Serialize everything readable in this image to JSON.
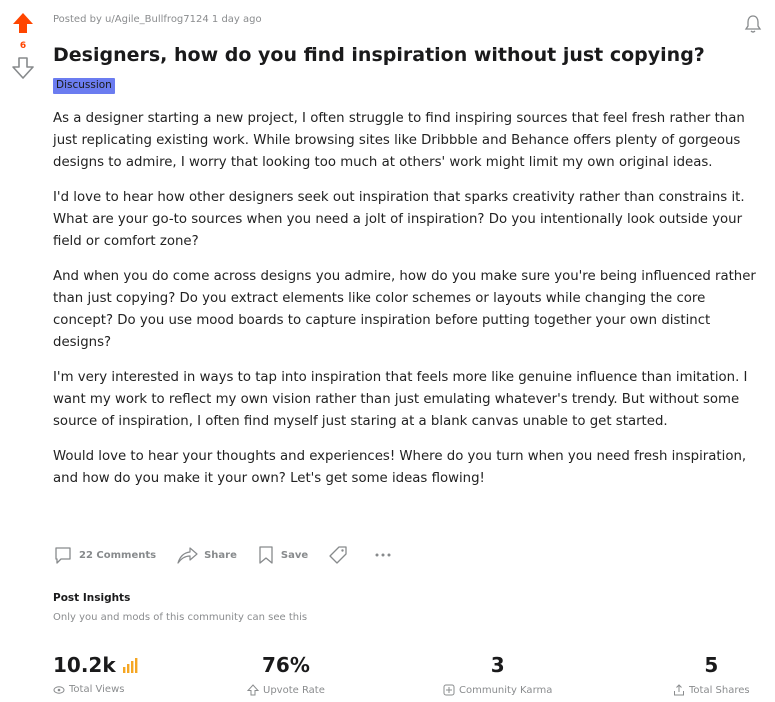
{
  "post": {
    "score": "6",
    "meta": "Posted by u/Agile_Bullfrog7124 1 day ago",
    "title": "Designers, how do you find inspiration without just copying?",
    "flair": "Discussion",
    "paragraphs": [
      "As a designer starting a new project, I often struggle to find inspiring sources that feel fresh rather than just replicating existing work. While browsing sites like Dribbble and Behance offers plenty of gorgeous designs to admire, I worry that looking too much at others' work might limit my own original ideas.",
      "I'd love to hear how other designers seek out inspiration that sparks creativity rather than constrains it. What are your go-to sources when you need a jolt of inspiration? Do you intentionally look outside your field or comfort zone?",
      "And when you do come across designs you admire, how do you make sure you're being influenced rather than just copying? Do you extract elements like color schemes or layouts while changing the core concept? Do you use mood boards to capture inspiration before putting together your own distinct designs?",
      "I'm very interested in ways to tap into inspiration that feels more like genuine influence than imitation. I want my work to reflect my own vision rather than just emulating whatever's trendy. But without some source of inspiration, I often find myself just staring at a blank canvas unable to get started.",
      "Would love to hear your thoughts and experiences! Where do you turn when you need fresh inspiration, and how do you make it your own? Let's get some ideas flowing!"
    ]
  },
  "actions": {
    "comments": "22 Comments",
    "share": "Share",
    "save": "Save"
  },
  "insights": {
    "title": "Post Insights",
    "subtitle": "Only you and mods of this community can see this",
    "stats": [
      {
        "value": "10.2k",
        "label": "Total Views"
      },
      {
        "value": "76%",
        "label": "Upvote Rate"
      },
      {
        "value": "3",
        "label": "Community Karma"
      },
      {
        "value": "5",
        "label": "Total Shares"
      }
    ]
  },
  "colors": {
    "upvote": "#ff4500",
    "flair": "#6b7cf0",
    "muted": "#878a8c"
  },
  "icons": [
    "upvote-icon",
    "downvote-icon",
    "bell-icon",
    "comment-icon",
    "share-icon",
    "save-icon",
    "tag-icon",
    "more-icon",
    "bar-chart-icon",
    "eye-icon",
    "arrow-up-icon",
    "karma-icon",
    "share-small-icon"
  ]
}
